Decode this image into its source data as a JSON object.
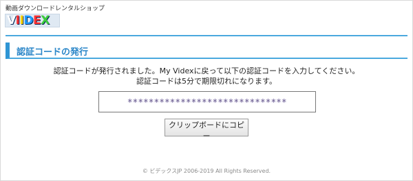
{
  "header": {
    "tagline": "動画ダウンロードレンタルショップ",
    "logo": {
      "letters": [
        {
          "char": "V",
          "color": "#ffffff"
        },
        {
          "char": "I",
          "color": "#ff2b2b"
        },
        {
          "char": "I",
          "color": "#ffd400"
        },
        {
          "char": "D",
          "color": "#1e9bff"
        },
        {
          "char": "E",
          "color": "#ff3030"
        },
        {
          "char": "X",
          "color": "#3ccf3c"
        }
      ],
      "background": "#dfe9f3"
    }
  },
  "section": {
    "title": "認証コードの発行",
    "accent_color": "#2f95d4"
  },
  "main": {
    "message_line1": "認証コードが発行されました。My Videxに戻って以下の認証コードを入力してください。",
    "message_line2": "認証コードは5分で期限切れになります。",
    "code_value": "******************************",
    "copy_button_label": "クリップボードにコピー"
  },
  "footer": {
    "copyright": "© ビデックスJP 2006-2019 All Rights Reserved."
  }
}
